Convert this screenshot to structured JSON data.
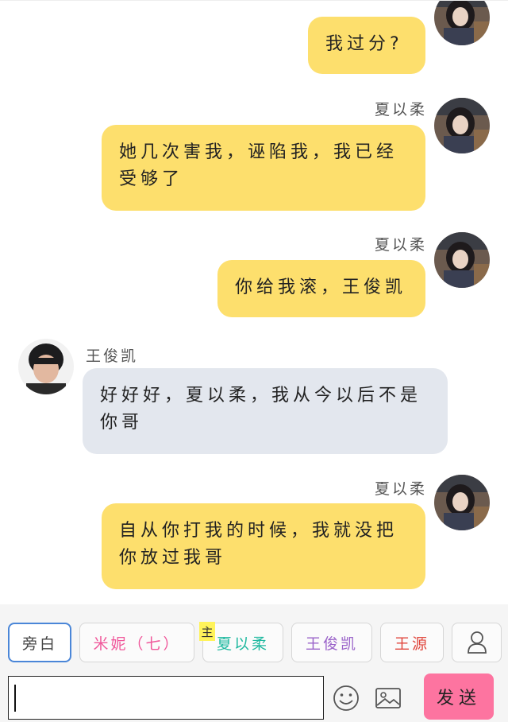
{
  "messages": [
    {
      "side": "right",
      "sender": "",
      "text": "我过分?"
    },
    {
      "side": "right",
      "sender": "夏以柔",
      "text": "她几次害我，诬陷我，我已经受够了"
    },
    {
      "side": "right",
      "sender": "夏以柔",
      "text": "你给我滚，王俊凯"
    },
    {
      "side": "left",
      "sender": "王俊凯",
      "text": "好好好，夏以柔，我从今以后不是你哥"
    },
    {
      "side": "right",
      "sender": "夏以柔",
      "text": "自从你打我的时候，我就没把你放过我哥"
    }
  ],
  "toolbar": {
    "roles": [
      {
        "label": "旁白",
        "color": "#444444",
        "active": true
      },
      {
        "label": "米妮（七）",
        "color": "#f0589b",
        "active": false
      },
      {
        "label": "夏以柔",
        "color": "#20b9a0",
        "active": false
      },
      {
        "label": "王俊凯",
        "color": "#9a63c9",
        "active": false
      },
      {
        "label": "王源",
        "color": "#e0463c",
        "active": false
      }
    ],
    "main_tag": "主",
    "send_label": "发送",
    "icons": {
      "person": "person-icon",
      "emoji": "emoji-icon",
      "image": "image-icon"
    }
  }
}
